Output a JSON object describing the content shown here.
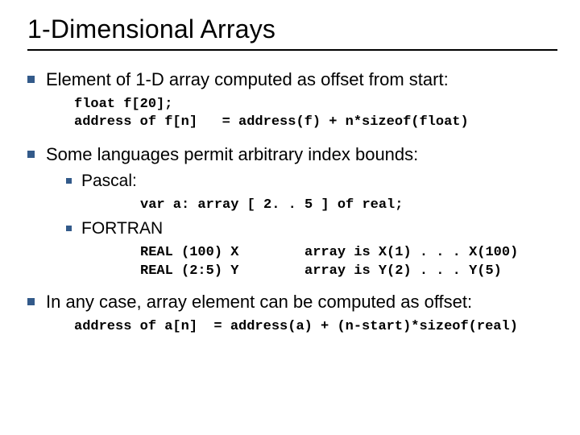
{
  "title": "1-Dimensional Arrays",
  "b1": {
    "text": "Element of 1-D array computed as offset from start:",
    "code": "float f[20];\naddress of f[n]   = address(f) + n*sizeof(float)"
  },
  "b2": {
    "text": "Some languages permit arbitrary index bounds:",
    "pascal": {
      "label": "Pascal:",
      "code": "var a: array [ 2. . 5 ] of real;"
    },
    "fortran": {
      "label": "FORTRAN",
      "code": "REAL (100) X        array is X(1) . . . X(100)\nREAL (2:5) Y        array is Y(2) . . . Y(5)"
    }
  },
  "b3": {
    "text": "In any case, array element can be computed as offset:",
    "code": "address of a[n]  = address(a) + (n-start)*sizeof(real)"
  }
}
